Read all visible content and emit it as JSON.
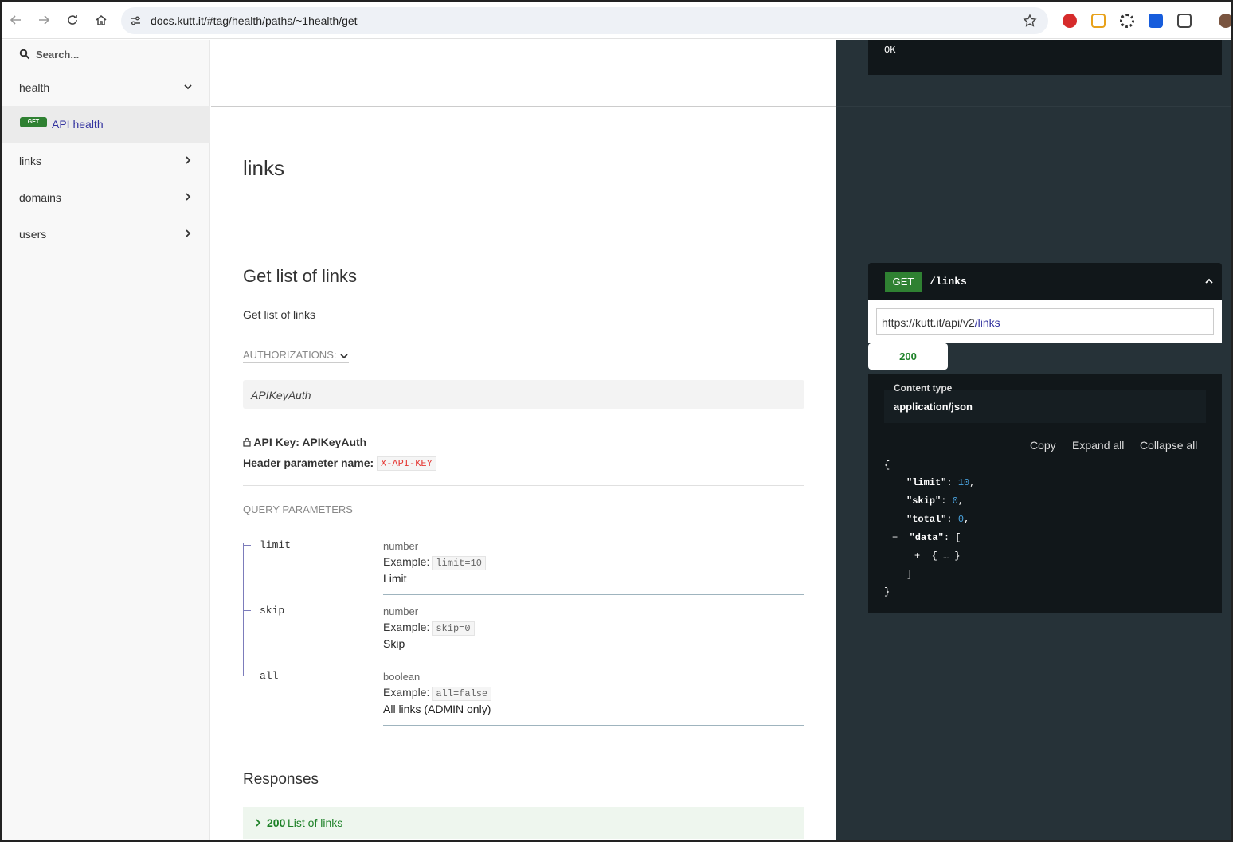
{
  "browser": {
    "url": "docs.kutt.it/#tag/health/paths/~1health/get"
  },
  "sidebar": {
    "search_placeholder": "Search...",
    "items": [
      {
        "label": "health"
      },
      {
        "label": "API health",
        "method": "GET"
      },
      {
        "label": "links"
      },
      {
        "label": "domains"
      },
      {
        "label": "users"
      }
    ]
  },
  "main": {
    "section_title": "links",
    "operation_title": "Get list of links",
    "operation_description": "Get list of links",
    "authorizations_label": "AUTHORIZATIONS:",
    "auth_scheme": "APIKeyAuth",
    "api_key_label": "API Key: APIKeyAuth",
    "header_param_label": "Header parameter name:",
    "header_param_value": "X-API-KEY",
    "query_params_title": "QUERY PARAMETERS",
    "params": [
      {
        "name": "limit",
        "type": "number",
        "example_label": "Example:",
        "example": "limit=10",
        "description": "Limit"
      },
      {
        "name": "skip",
        "type": "number",
        "example_label": "Example:",
        "example": "skip=0",
        "description": "Skip"
      },
      {
        "name": "all",
        "type": "boolean",
        "example_label": "Example:",
        "example": "all=false",
        "description": "All links (ADMIN only)"
      }
    ],
    "responses_title": "Responses",
    "response": {
      "code": "200",
      "description": "List of links"
    }
  },
  "right": {
    "prev_response": "OK",
    "method": "GET",
    "path": "/links",
    "server_base": "https://kutt.it/api/v2",
    "server_path": "/links",
    "status_tab": "200",
    "content_type_label": "Content type",
    "content_type": "application/json",
    "buttons": {
      "copy": "Copy",
      "expand": "Expand all",
      "collapse": "Collapse all"
    },
    "json": {
      "open": "{",
      "limit_key": "\"limit\"",
      "limit_val": "10",
      "skip_key": "\"skip\"",
      "skip_val": "0",
      "total_key": "\"total\"",
      "total_val": "0",
      "data_toggle": "−",
      "data_key": "\"data\"",
      "array_open": "[",
      "item_toggle": "+",
      "item": "{ … }",
      "array_close": "]",
      "close": "}"
    }
  },
  "colors": {
    "get_badge": "#2f8132",
    "status_ok": "#1d8127",
    "right_panel_bg": "#263238",
    "code_bg": "#11171a"
  }
}
